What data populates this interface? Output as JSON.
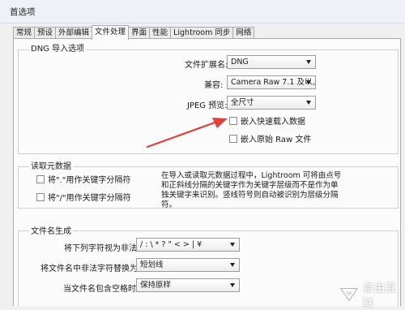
{
  "window": {
    "title": "首选项"
  },
  "tabs": [
    {
      "label": "常规",
      "active": false
    },
    {
      "label": "预设",
      "active": false
    },
    {
      "label": "外部编辑",
      "active": false
    },
    {
      "label": "文件处理",
      "active": true
    },
    {
      "label": "界面",
      "active": false
    },
    {
      "label": "性能",
      "active": false
    },
    {
      "label": "Lightroom 同步",
      "active": false
    },
    {
      "label": "网络",
      "active": false
    }
  ],
  "dng": {
    "title": "DNG 导入选项",
    "extension": {
      "label": "文件扩展名:",
      "value": "DNG"
    },
    "compat": {
      "label": "兼容:",
      "value": "Camera Raw 7.1 及以上"
    },
    "jpeg": {
      "label": "JPEG 预览:",
      "value": "全尺寸"
    },
    "embed_fast": {
      "label": "嵌入快速载入数据",
      "checked": false
    },
    "embed_raw": {
      "label": "嵌入原始 Raw 文件",
      "checked": false
    }
  },
  "metadata": {
    "title": "读取元数据",
    "dot_sep": {
      "label": "将\".\"用作关键字分隔符",
      "checked": false
    },
    "slash_sep": {
      "label": "将\"/\"用作关键字分隔符",
      "checked": false
    },
    "description": "在导入或读取元数据过程中，Lightroom 可将由点号和正斜线分隔的关键字作为关键字层级而不是作为单独关键字来识别。竖线符号则自动被识别为层级分隔符。"
  },
  "filename": {
    "title": "文件名生成",
    "illegal_chars": {
      "label": "将下列字符视为非法:",
      "value": "/ : \\ * ? \" < > | ¥"
    },
    "replace_with": {
      "label": "将文件名中非法字符替换为:",
      "value": "短划线"
    },
    "spaces": {
      "label": "当文件名包含空格时:",
      "value": "保持原样"
    }
  },
  "watermark": {
    "text": "自由互联"
  },
  "colors": {
    "annotation_arrow": "#e0413a"
  }
}
